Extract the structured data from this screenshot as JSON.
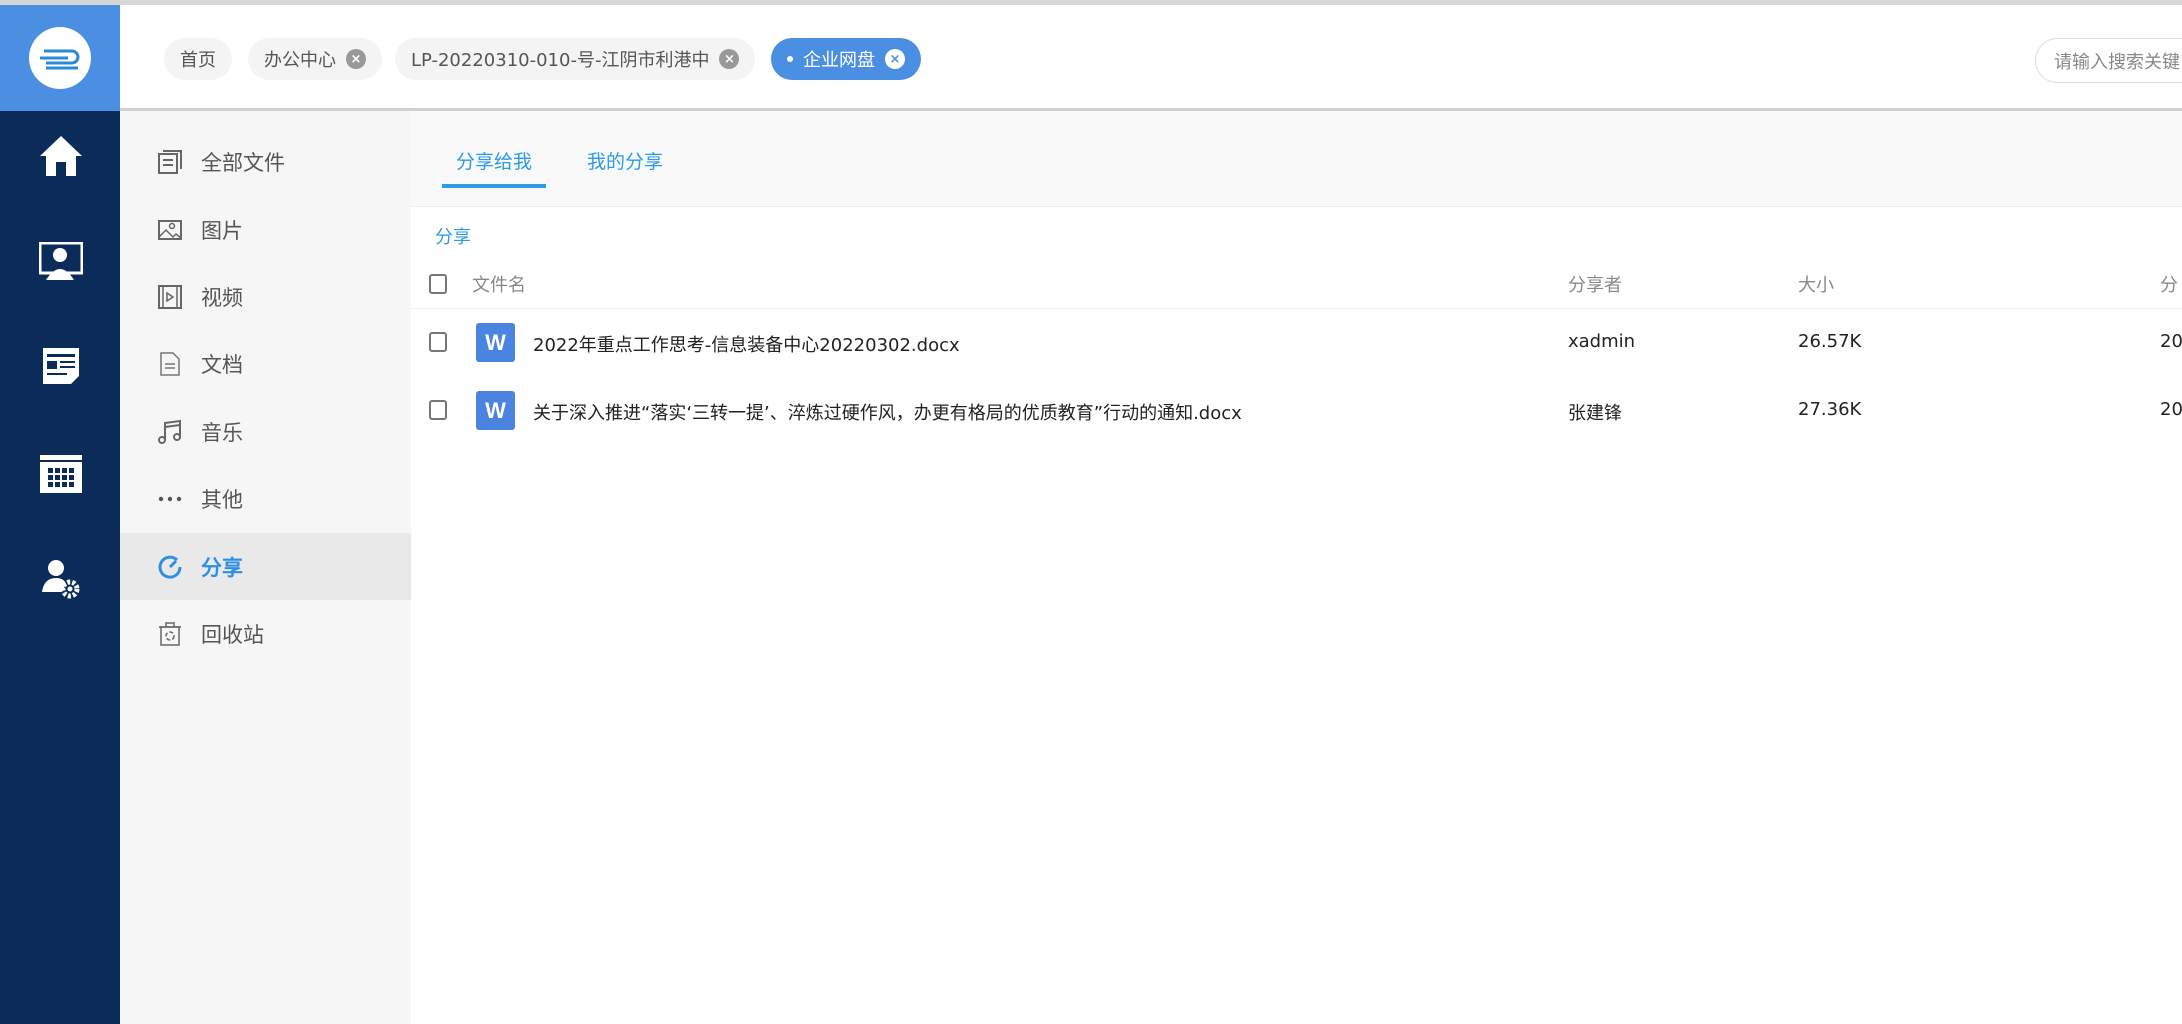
{
  "header": {
    "tabs": [
      {
        "label": "首页",
        "closable": false
      },
      {
        "label": "办公中心",
        "closable": true
      },
      {
        "label": "LP-20220310-010-号-江阴市利港中",
        "closable": true
      },
      {
        "label": "企业网盘",
        "closable": true,
        "active": true
      }
    ],
    "close_glyph": "×",
    "search_placeholder": "请输入搜索关键"
  },
  "rail": {
    "icons": [
      "home-icon",
      "monitor-user-icon",
      "news-icon",
      "calendar-icon",
      "user-settings-icon"
    ]
  },
  "sidebar": {
    "items": [
      {
        "label": "全部文件",
        "icon": "files-icon"
      },
      {
        "label": "图片",
        "icon": "image-icon"
      },
      {
        "label": "视频",
        "icon": "video-icon"
      },
      {
        "label": "文档",
        "icon": "document-icon"
      },
      {
        "label": "音乐",
        "icon": "music-icon"
      },
      {
        "label": "其他",
        "icon": "more-icon"
      },
      {
        "label": "分享",
        "icon": "share-icon",
        "selected": true
      },
      {
        "label": "回收站",
        "icon": "recycle-bin-icon"
      }
    ]
  },
  "main": {
    "tabs": [
      {
        "label": "分享给我",
        "selected": true
      },
      {
        "label": "我的分享"
      }
    ],
    "breadcrumb": "分享",
    "columns": {
      "name": "文件名",
      "sharer": "分享者",
      "size": "大小",
      "date": "分"
    },
    "file_icon_letter": "W",
    "rows": [
      {
        "name": "2022年重点工作思考-信息装备中心20220302.docx",
        "sharer": "xadmin",
        "size": "26.57K",
        "date": "20"
      },
      {
        "name": "关于深入推进“落实‘三转一提’、淬炼过硬作风，办更有格局的优质教育”行动的通知.docx",
        "sharer": "张建锋",
        "size": "27.36K",
        "date": "20"
      }
    ]
  },
  "colors": {
    "brand": "#4a8fe2",
    "rail": "#0b2c59",
    "accent": "#2d9be6"
  }
}
